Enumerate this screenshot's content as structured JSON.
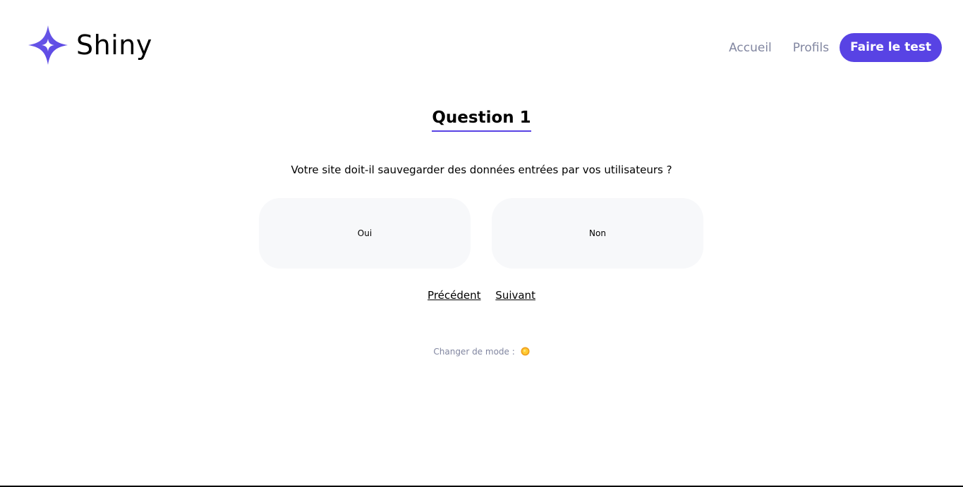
{
  "brand": {
    "name": "Shiny",
    "color": "#5843e4"
  },
  "nav": {
    "home_label": "Accueil",
    "profiles_label": "Profils",
    "cta_label": "Faire le test"
  },
  "survey": {
    "title": "Question 1",
    "question": "Votre site doit-il sauvegarder des données entrées par vos utilisateurs ?",
    "answers": {
      "yes_label": "Oui",
      "no_label": "Non"
    },
    "pager": {
      "previous_label": "Précédent",
      "next_label": "Suivant"
    }
  },
  "footer": {
    "mode_label": "Changer de mode :",
    "mode_icon": "sun-icon"
  },
  "colors": {
    "accent": "#5843e4",
    "nav_text": "#8186a0",
    "answer_bg": "#f7f8fa"
  }
}
